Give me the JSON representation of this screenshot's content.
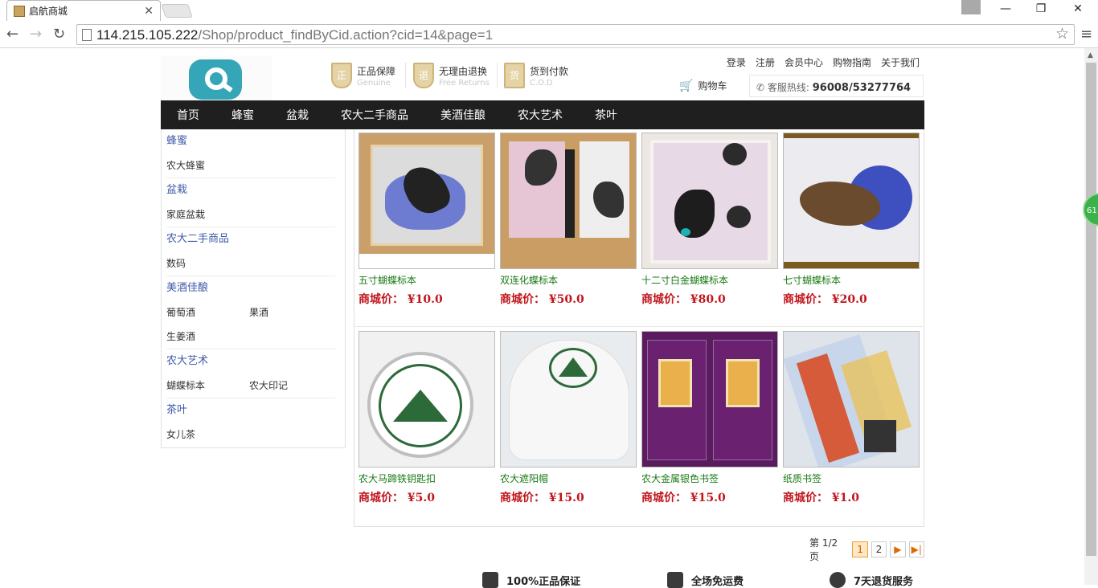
{
  "browser": {
    "tab_title": "启航商城",
    "url_host": "114.215.105.222",
    "url_path": "/Shop/product_findByCid.action?cid=14&page=1"
  },
  "header": {
    "promises": [
      {
        "title": "正品保障",
        "subtitle": "Genuine",
        "badge": "正"
      },
      {
        "title": "无理由退换",
        "subtitle": "Free Returns",
        "badge": "退"
      },
      {
        "title": "货到付款",
        "subtitle": "C.O.D",
        "badge": "货"
      }
    ],
    "links": [
      "登录",
      "注册",
      "会员中心",
      "购物指南",
      "关于我们"
    ],
    "cart_label": "购物车",
    "hotline_label": "客服热线:",
    "hotline_number": "96008/53277764"
  },
  "nav": [
    "首页",
    "蜂蜜",
    "盆栽",
    "农大二手商品",
    "美酒佳酿",
    "农大艺术",
    "茶叶"
  ],
  "sidebar": [
    {
      "title": "蜂蜜",
      "subs": [
        "农大蜂蜜"
      ]
    },
    {
      "title": "盆栽",
      "subs": [
        "家庭盆栽"
      ]
    },
    {
      "title": "农大二手商品",
      "subs": [
        "数码"
      ]
    },
    {
      "title": "美酒佳酿",
      "subs": [
        "葡萄酒",
        "果酒",
        "生姜酒"
      ]
    },
    {
      "title": "农大艺术",
      "subs": [
        "蝴蝶标本",
        "农大印记"
      ]
    },
    {
      "title": "茶叶",
      "subs": [
        "女儿茶"
      ]
    }
  ],
  "price_label": "商城价：",
  "products": [
    {
      "name": "五寸蝴蝶标本",
      "price": "¥10.0"
    },
    {
      "name": "双连化蝶标本",
      "price": "¥50.0"
    },
    {
      "name": "十二寸白金蝴蝶标本",
      "price": "¥80.0"
    },
    {
      "name": "七寸蝴蝶标本",
      "price": "¥20.0"
    },
    {
      "name": "农大马蹄铁钥匙扣",
      "price": "¥5.0"
    },
    {
      "name": "农大遮阳帽",
      "price": "¥15.0"
    },
    {
      "name": "农大金属银色书签",
      "price": "¥15.0"
    },
    {
      "name": "纸质书签",
      "price": "¥1.0"
    }
  ],
  "pager": {
    "text": "第 1/2 页",
    "pages": [
      "1",
      "2"
    ],
    "next": "▶",
    "last": "▶|"
  },
  "footer": [
    "100%正品保证",
    "全场免运费",
    "7天退货服务"
  ],
  "floating_badge": "61"
}
